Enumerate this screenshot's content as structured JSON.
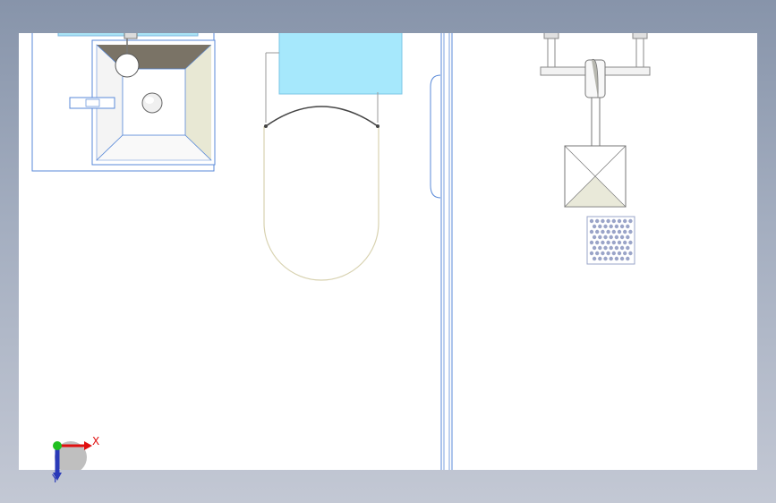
{
  "viewport": {
    "background": "#ffffff",
    "edge_color": "#5a8ad8"
  },
  "triad": {
    "x_axis_label": "X",
    "y_axis_label": "Y",
    "x_color": "#e01010",
    "y_color": "#2a3ab8",
    "origin_color": "#20c020"
  },
  "fixtures": {
    "vanity_sink": "sink-basin",
    "toilet": "toilet-bowl",
    "partition": "partition-wall",
    "shower_arm": "shower-arm",
    "shower_head": "shower-head-square"
  }
}
